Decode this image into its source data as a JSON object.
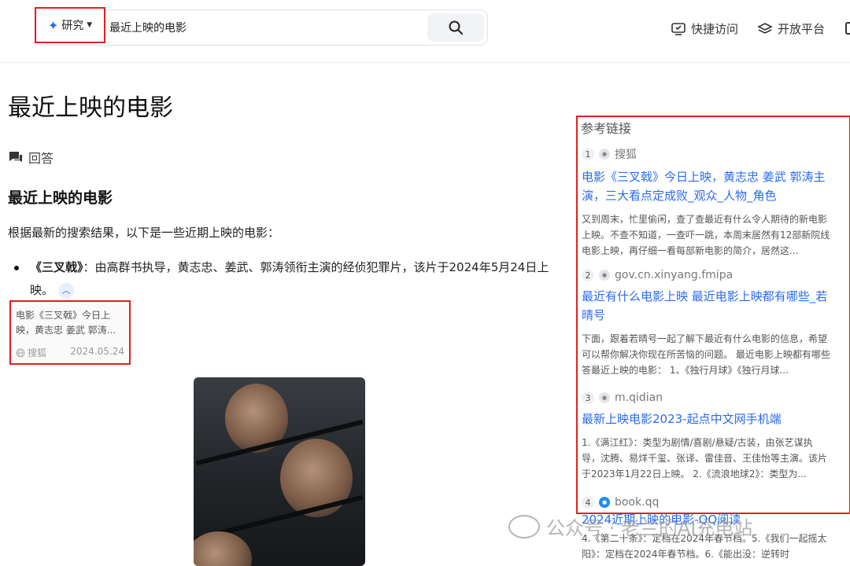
{
  "header": {
    "mode_label": "研究",
    "query": "最近上映的电影",
    "links": [
      {
        "label": "快捷访问",
        "icon": "monitor-icon"
      },
      {
        "label": "开放平台",
        "icon": "layers-icon"
      }
    ]
  },
  "main": {
    "title": "最近上映的电影",
    "answer_label": "回答",
    "heading": "最近上映的电影",
    "intro": "根据最新的搜索结果，以下是一些近期上映的电影：",
    "bullets": [
      {
        "name": "《三叉戟》",
        "text": "：由高群书执导，黄志忠、姜武、郭涛领衔主演的经侦犯罪片，该片于2024年5月24日上映。"
      }
    ],
    "citation": {
      "text": "电影《三叉戟》今日上映，黄志忠 姜武 郭涛...",
      "source": "搜狐",
      "date": "2024.05.24"
    }
  },
  "refs": {
    "title": "参考链接",
    "items": [
      {
        "num": "1",
        "site": "搜狐",
        "title": "电影《三叉戟》今日上映，黄志忠 姜武 郭涛主演，三大看点定成败_观众_人物_角色",
        "snippet": "又到周末，忙里偷闲，查了查最近有什么令人期待的新电影上映。不查不知道，一查吓一跳，本周末居然有12部新院线电影上映，再仔细一看每部新电影的简介，居然这..."
      },
      {
        "num": "2",
        "site": "gov.cn.xinyang.fmipa",
        "title": "最近有什么电影上映 最近电影上映都有哪些_若晴号",
        "snippet": "下面，跟着若晴号一起了解下最近有什么电影的信息，希望可以帮你解决你现在所苦恼的问题。 最近电影上映都有哪些 答最近上映的电影： 1、《独行月球》《独行月球..."
      },
      {
        "num": "3",
        "site": "m.qidian",
        "title": "最新上映电影2023-起点中文网手机端",
        "snippet": "1.《满江红》：类型为剧情/喜剧/悬疑/古装，由张艺谋执导，沈腾、易烊千玺、张译、雷佳音、王佳怡等主演。该片于2023年1月22日上映。 2.《流浪地球2》：类型为..."
      },
      {
        "num": "4",
        "site": "book.qq",
        "title": "2024近期上映的电影-QQ阅读",
        "snippet": "4.《第二十条》：定档在2024年春节档。5.《我们一起摇太阳》：定档在2024年春节档。6.《能出没：逆转时"
      }
    ]
  },
  "watermark": "公众号 · 老兰的AI充电站"
}
